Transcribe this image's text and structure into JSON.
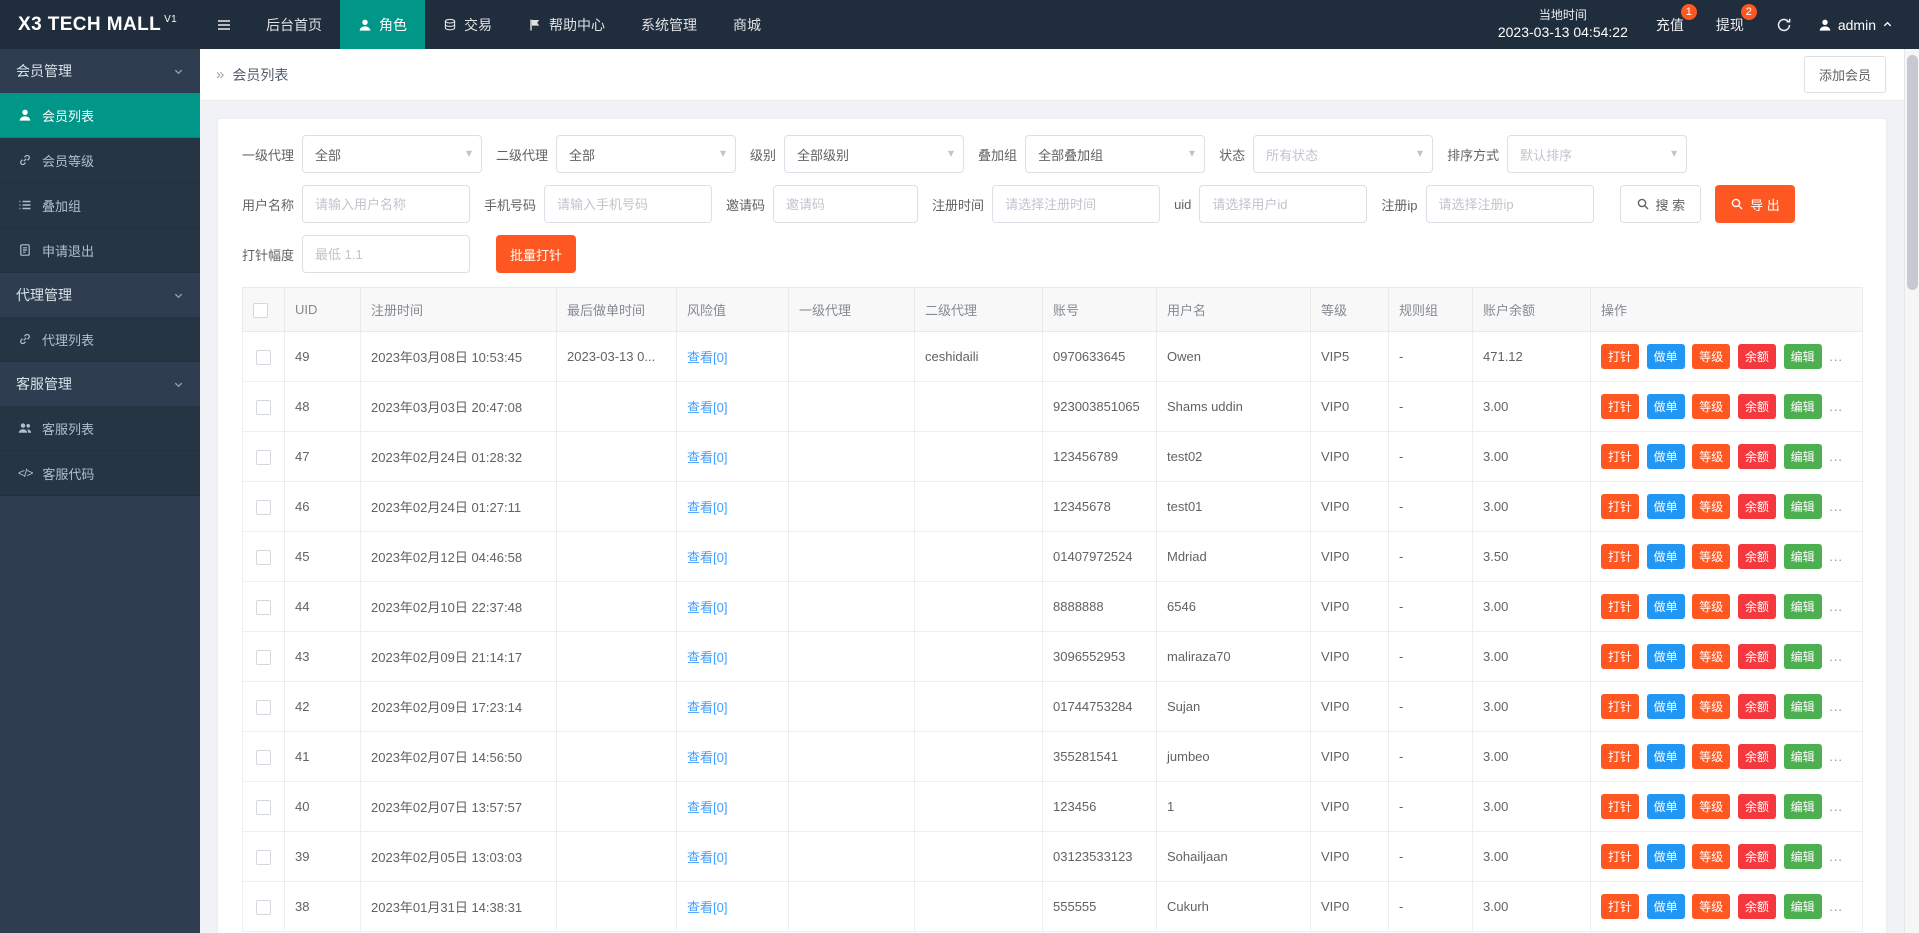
{
  "colors": {
    "navbar_bg": "#1f2d3d",
    "sidebar_bg": "#2e3e50",
    "accent_teal": "#009688",
    "accent_orange": "#ff5722",
    "link_blue": "#409eff",
    "danger_red": "#f5383d",
    "success_green": "#4caf50",
    "info_blue": "#2196f3"
  },
  "icons": {
    "caret_down": "▾",
    "breadcrumb_arrows": "»",
    "code": "</>"
  },
  "navbar": {
    "logo_text": "X3 TECH MALL",
    "logo_version": "V1",
    "menu": [
      {
        "label": "后台首页"
      },
      {
        "label": "角色",
        "active": true
      },
      {
        "label": "交易"
      },
      {
        "label": "帮助中心"
      },
      {
        "label": "系统管理"
      },
      {
        "label": "商城"
      }
    ],
    "time_label": "当地时间",
    "time_value": "2023-03-13 04:54:22",
    "recharge_label": "充值",
    "recharge_badge": "1",
    "withdraw_label": "提现",
    "withdraw_badge": "2",
    "username": "admin"
  },
  "sidebar": {
    "sections": [
      {
        "label": "会员管理",
        "items": [
          {
            "label": "会员列表",
            "active": true
          },
          {
            "label": "会员等级"
          },
          {
            "label": "叠加组"
          },
          {
            "label": "申请退出"
          }
        ]
      },
      {
        "label": "代理管理",
        "items": [
          {
            "label": "代理列表"
          }
        ]
      },
      {
        "label": "客服管理",
        "items": [
          {
            "label": "客服列表"
          },
          {
            "label": "客服代码"
          }
        ]
      }
    ]
  },
  "breadcrumb": {
    "title": "会员列表",
    "add_button_label": "添加会员"
  },
  "filters": {
    "selects": [
      {
        "label": "一级代理",
        "value": "全部"
      },
      {
        "label": "二级代理",
        "value": "全部"
      },
      {
        "label": "级别",
        "value": "全部级别"
      },
      {
        "label": "叠加组",
        "value": "全部叠加组"
      },
      {
        "label": "状态",
        "value": "所有状态"
      },
      {
        "label": "排序方式",
        "value": "默认排序"
      }
    ],
    "inputs": [
      {
        "label": "用户名称",
        "placeholder": "请输入用户名称"
      },
      {
        "label": "手机号码",
        "placeholder": "请输入手机号码"
      },
      {
        "label": "邀请码",
        "placeholder": "邀请码"
      },
      {
        "label": "注册时间",
        "placeholder": "请选择注册时间"
      },
      {
        "label": "uid",
        "placeholder": "请选择用户id"
      },
      {
        "label": "注册ip",
        "placeholder": "请选择注册ip"
      }
    ],
    "search_label": "搜 索",
    "export_label": "导 出",
    "inject_label": "打针幅度",
    "inject_placeholder": "最低 1.1",
    "batch_inject_label": "批量打针"
  },
  "table": {
    "headers": [
      "UID",
      "注册时间",
      "最后做单时间",
      "风险值",
      "一级代理",
      "二级代理",
      "账号",
      "用户名",
      "等级",
      "规则组",
      "账户余额",
      "操作"
    ],
    "action_labels": [
      "打针",
      "做单",
      "等级",
      "余额",
      "编辑"
    ],
    "more_label": "...",
    "rows": [
      {
        "uid": "49",
        "register_time": "2023年03月08日 10:53:45",
        "last_order_time": "2023-03-13 0...",
        "risk": "查看[0]",
        "agent1": "",
        "agent2": "ceshidaili",
        "account": "0970633645",
        "username": "Owen",
        "level": "VIP5",
        "rule_group": "-",
        "balance": "471.12"
      },
      {
        "uid": "48",
        "register_time": "2023年03月03日 20:47:08",
        "last_order_time": "",
        "risk": "查看[0]",
        "agent1": "",
        "agent2": "",
        "account": "923003851065",
        "username": "Shams uddin",
        "level": "VIP0",
        "rule_group": "-",
        "balance": "3.00"
      },
      {
        "uid": "47",
        "register_time": "2023年02月24日 01:28:32",
        "last_order_time": "",
        "risk": "查看[0]",
        "agent1": "",
        "agent2": "",
        "account": "123456789",
        "username": "test02",
        "level": "VIP0",
        "rule_group": "-",
        "balance": "3.00"
      },
      {
        "uid": "46",
        "register_time": "2023年02月24日 01:27:11",
        "last_order_time": "",
        "risk": "查看[0]",
        "agent1": "",
        "agent2": "",
        "account": "12345678",
        "username": "test01",
        "level": "VIP0",
        "rule_group": "-",
        "balance": "3.00"
      },
      {
        "uid": "45",
        "register_time": "2023年02月12日 04:46:58",
        "last_order_time": "",
        "risk": "查看[0]",
        "agent1": "",
        "agent2": "",
        "account": "01407972524",
        "username": "Mdriad",
        "level": "VIP0",
        "rule_group": "-",
        "balance": "3.50"
      },
      {
        "uid": "44",
        "register_time": "2023年02月10日 22:37:48",
        "last_order_time": "",
        "risk": "查看[0]",
        "agent1": "",
        "agent2": "",
        "account": "8888888",
        "username": "6546",
        "level": "VIP0",
        "rule_group": "-",
        "balance": "3.00"
      },
      {
        "uid": "43",
        "register_time": "2023年02月09日 21:14:17",
        "last_order_time": "",
        "risk": "查看[0]",
        "agent1": "",
        "agent2": "",
        "account": "3096552953",
        "username": "maliraza70",
        "level": "VIP0",
        "rule_group": "-",
        "balance": "3.00"
      },
      {
        "uid": "42",
        "register_time": "2023年02月09日 17:23:14",
        "last_order_time": "",
        "risk": "查看[0]",
        "agent1": "",
        "agent2": "",
        "account": "01744753284",
        "username": "Sujan",
        "level": "VIP0",
        "rule_group": "-",
        "balance": "3.00"
      },
      {
        "uid": "41",
        "register_time": "2023年02月07日 14:56:50",
        "last_order_time": "",
        "risk": "查看[0]",
        "agent1": "",
        "agent2": "",
        "account": "355281541",
        "username": "jumbeo",
        "level": "VIP0",
        "rule_group": "-",
        "balance": "3.00"
      },
      {
        "uid": "40",
        "register_time": "2023年02月07日 13:57:57",
        "last_order_time": "",
        "risk": "查看[0]",
        "agent1": "",
        "agent2": "",
        "account": "123456",
        "username": "1",
        "level": "VIP0",
        "rule_group": "-",
        "balance": "3.00"
      },
      {
        "uid": "39",
        "register_time": "2023年02月05日 13:03:03",
        "last_order_time": "",
        "risk": "查看[0]",
        "agent1": "",
        "agent2": "",
        "account": "03123533123",
        "username": "Sohailjaan",
        "level": "VIP0",
        "rule_group": "-",
        "balance": "3.00"
      },
      {
        "uid": "38",
        "register_time": "2023年01月31日 14:38:31",
        "last_order_time": "",
        "risk": "查看[0]",
        "agent1": "",
        "agent2": "",
        "account": "555555",
        "username": "Cukurh",
        "level": "VIP0",
        "rule_group": "-",
        "balance": "3.00"
      }
    ]
  }
}
